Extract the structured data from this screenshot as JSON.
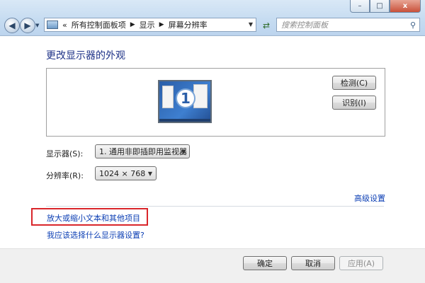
{
  "window": {
    "controls": {
      "minimize": "–",
      "maximize": "□",
      "close": "x"
    }
  },
  "nav": {
    "back_icon": "back-arrow-icon",
    "forward_icon": "forward-arrow-icon",
    "breadcrumb": [
      "«",
      "所有控制面板项",
      "显示",
      "屏幕分辨率"
    ],
    "refresh_icon": "refresh-icon",
    "search_placeholder": "搜索控制面板"
  },
  "main": {
    "title": "更改显示器的外观",
    "monitor_number": "1",
    "detect_button": "检测(C)",
    "identify_button": "识别(I)",
    "display_label": "显示器(S):",
    "display_value": "1. 通用非即插即用监视器",
    "resolution_label": "分辨率(R):",
    "resolution_value": "1024 × 768",
    "advanced_link": "高级设置",
    "text_size_link": "放大或缩小文本和其他项目",
    "help_link": "我应该选择什么显示器设置?"
  },
  "footer": {
    "ok": "确定",
    "cancel": "取消",
    "apply": "应用(A)"
  },
  "colors": {
    "heading": "#1e3287",
    "link": "#0b3eb4",
    "highlight_border": "#d9262b",
    "chrome": "#c6dcf1"
  }
}
